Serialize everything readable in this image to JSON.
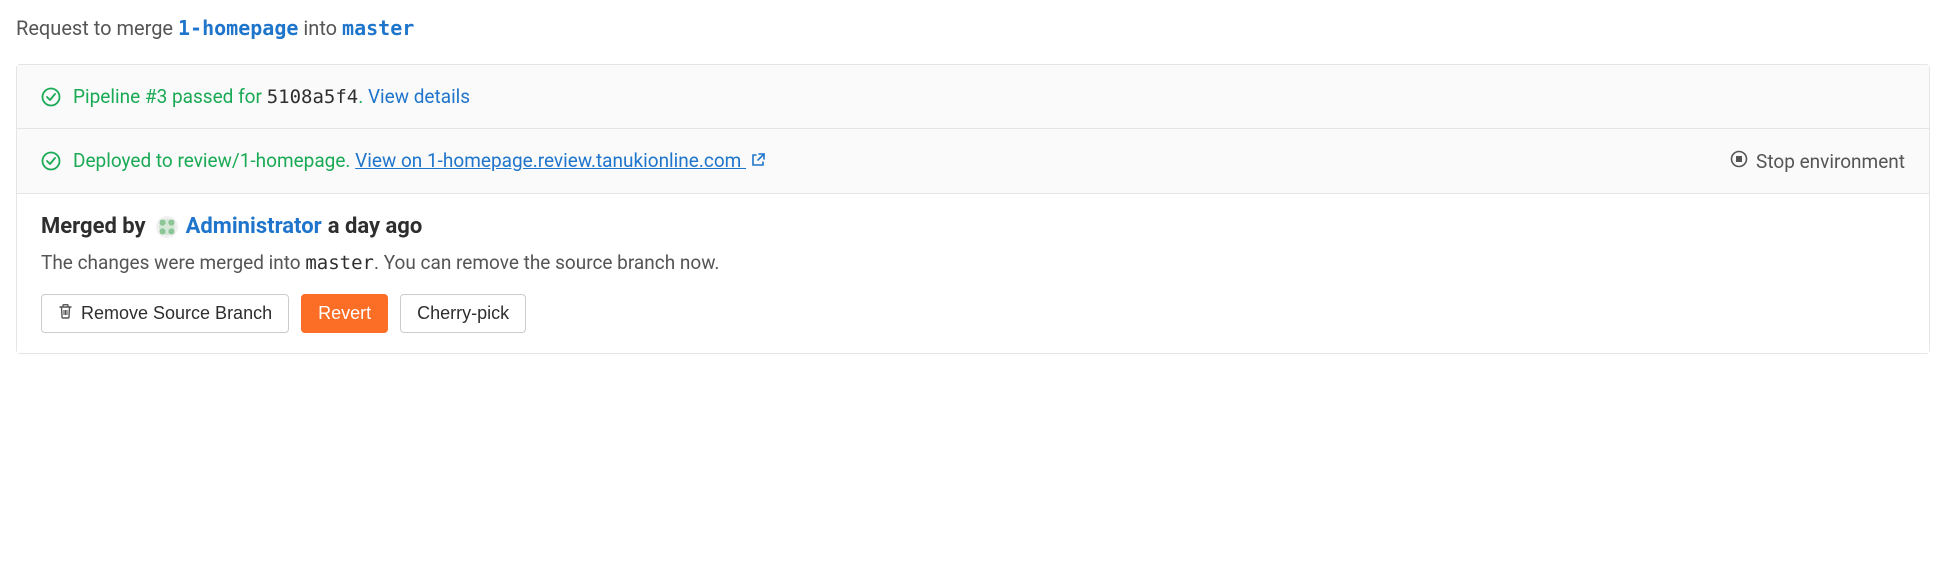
{
  "header": {
    "prefix": "Request to merge ",
    "source_branch": "1-homepage",
    "middle": " into ",
    "target_branch": "master"
  },
  "pipeline": {
    "text_before_sha": "Pipeline #3 passed for ",
    "sha": "5108a5f4",
    "period": ". ",
    "view_details": "View details"
  },
  "deploy": {
    "text": "Deployed to review/1-homepage. ",
    "link_text": "View on 1-homepage.review.tanukionline.com ",
    "stop_label": "Stop environment"
  },
  "merged": {
    "prefix": "Merged by",
    "user": "Administrator",
    "time": "a day ago",
    "description_before": "The changes were merged into ",
    "description_branch": "master",
    "description_after": ". You can remove the source branch now."
  },
  "buttons": {
    "remove": "Remove Source Branch",
    "revert": "Revert",
    "cherry_pick": "Cherry-pick"
  }
}
